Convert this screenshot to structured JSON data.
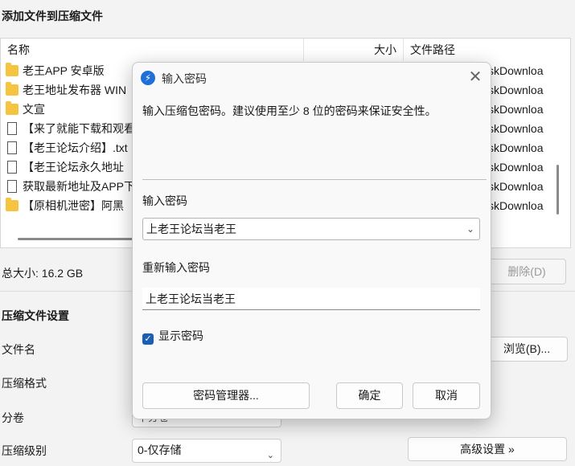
{
  "window": {
    "title": "添加文件到压缩文件",
    "columns": {
      "name": "名称",
      "size": "大小",
      "path": "文件路径"
    },
    "files": [
      {
        "icon": "folder-icon",
        "name": "老王APP 安卓版",
        "path": "skDownloa"
      },
      {
        "icon": "folder-icon",
        "name": "老王地址发布器 WIN",
        "path": "skDownloa"
      },
      {
        "icon": "folder-icon",
        "name": "文宣",
        "path": "skDownloa"
      },
      {
        "icon": "file-icon",
        "name": "【来了就能下载和观看",
        "path": "skDownloa"
      },
      {
        "icon": "file-icon",
        "name": "【老王论坛介绍】.txt",
        "path": "skDownloa"
      },
      {
        "icon": "file-icon",
        "name": "【老王论坛永久地址",
        "path": "skDownloa"
      },
      {
        "icon": "file-icon",
        "name": "获取最新地址及APP下",
        "path": "skDownloa"
      },
      {
        "icon": "folder-icon",
        "name": "【原相机泄密】阿黑",
        "path": "skDownloa"
      }
    ],
    "total_size": "总大小: 16.2 GB",
    "delete_label": "删除(D)",
    "settings_title": "压缩文件设置",
    "labels": {
      "filename": "文件名",
      "format": "压缩格式",
      "split": "分卷",
      "level": "压缩级别"
    },
    "browse_label": "浏览(B)...",
    "bracket_text": "]",
    "split_value": "不分卷",
    "level_value": "0-仅存储",
    "advanced_label": "高级设置 »"
  },
  "dialog": {
    "title": "输入密码",
    "description": "输入压缩包密码。建议使用至少 8 位的密码来保证安全性。",
    "password_label": "输入密码",
    "password_value": "上老王论坛当老王",
    "reenter_label": "重新输入密码",
    "reenter_value": "上老王论坛当老王",
    "show_password_label": "显示密码",
    "show_password_checked": true,
    "password_manager_label": "密码管理器...",
    "ok_label": "确定",
    "cancel_label": "取消",
    "accent_color": "#1a5fb4"
  }
}
